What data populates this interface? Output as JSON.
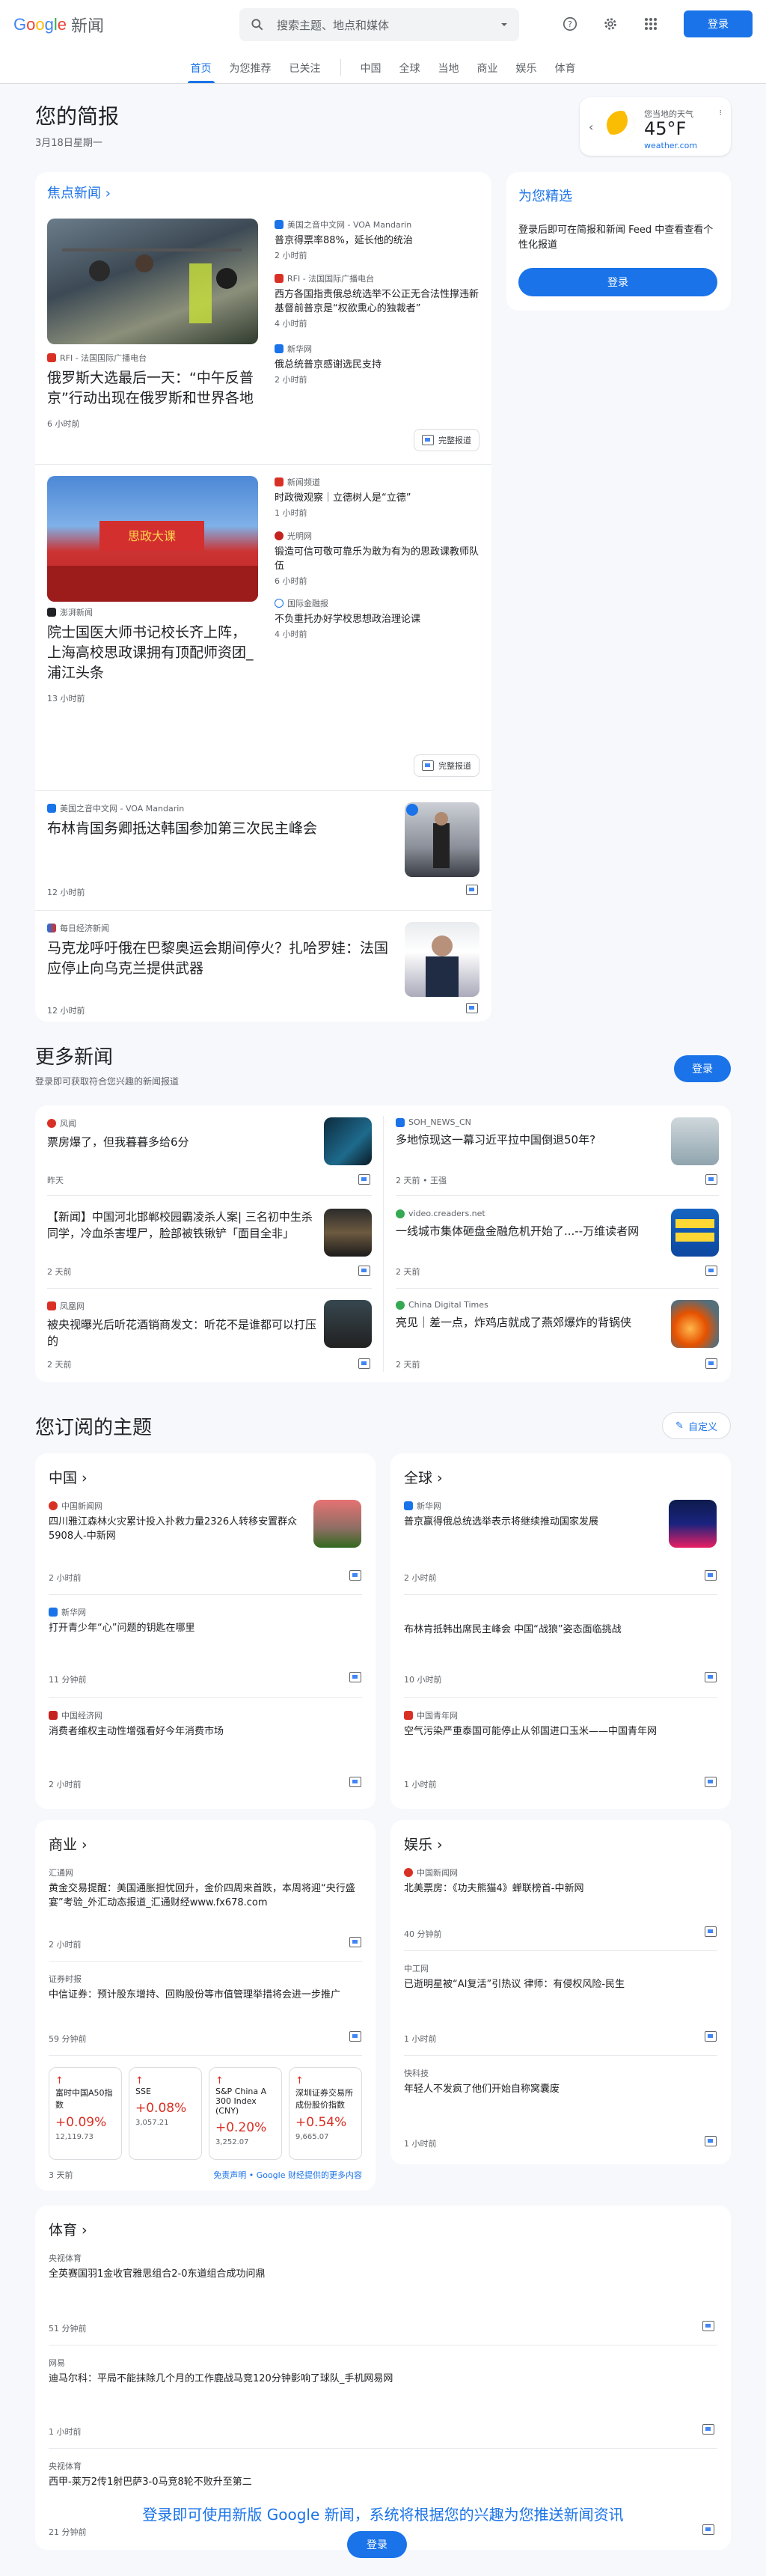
{
  "header": {
    "logo_letters": [
      "G",
      "o",
      "o",
      "g",
      "l",
      "e"
    ],
    "logo_suffix": "新闻",
    "search_placeholder": "搜索主题、地点和媒体",
    "login_label": "登录"
  },
  "nav": {
    "tabs": [
      "首页",
      "为您推荐",
      "已关注",
      "中国",
      "全球",
      "当地",
      "商业",
      "娱乐",
      "体育"
    ],
    "active": "首页"
  },
  "briefing": {
    "title": "您的简报",
    "date": "3月18日星期一"
  },
  "weather": {
    "location": "您当地的天气",
    "temp": "45°F",
    "source": "weather.com"
  },
  "top_stories": {
    "heading": "焦点新闻",
    "full_coverage_label": "完整报道",
    "clusters": [
      {
        "main": {
          "source": "RFI - 法国国际广播电台",
          "title": "俄罗斯大选最后一天：“中午反普京”行动出现在俄罗斯和世界各地",
          "time": "6 小时前"
        },
        "side": [
          {
            "source": "美国之音中文网 - VOA Mandarin",
            "title": "普京得票率88%，延长他的统治",
            "time": "2 小时前"
          },
          {
            "source": "RFI - 法国国际广播电台",
            "title": "西方各国指责俄总统选举不公正无合法性撑违新基督前普京是“权欲熏心的独裁者”",
            "time": "4 小时前"
          },
          {
            "source": "新华网",
            "title": "俄总统普京感谢选民支持",
            "time": "2 小时前"
          }
        ]
      },
      {
        "main": {
          "source": "澎湃新闻",
          "title": "院士国医大师书记校长齐上阵，上海高校思政课拥有顶配师资团_浦江头条",
          "time": "13 小时前"
        },
        "side": [
          {
            "source": "新闻频道",
            "title": "时政微观察｜立德树人是“立德”",
            "time": "1 小时前"
          },
          {
            "source": "光明网",
            "title": "锻造可信可敬可靠乐为敢为有为的思政课教师队伍",
            "time": "6 小时前"
          },
          {
            "source": "国际金融报",
            "title": "不负重托办好学校思想政治理论课",
            "time": "4 小时前"
          }
        ]
      }
    ],
    "singles": [
      {
        "source": "美国之音中文网 - VOA Mandarin",
        "title": "布林肯国务卿抵达韩国参加第三次民主峰会",
        "time": "12 小时前"
      },
      {
        "source": "每日经济新闻",
        "title": "马克龙呼吁俄在巴黎奥运会期间停火？扎哈罗娃：法国应停止向乌克兰提供武器",
        "time": "12 小时前"
      }
    ]
  },
  "picks": {
    "title": "为您精选",
    "text": "登录后即可在简报和新闻 Feed 中查看查看个性化报道",
    "button": "登录"
  },
  "more_news": {
    "title": "更多新闻",
    "subtitle": "登录即可获取符合您兴趣的新闻报道",
    "button": "登录",
    "items": [
      {
        "source": "风闻",
        "title": "票房爆了，但我暮暮多给6分",
        "time": "昨天"
      },
      {
        "source": "SOH_NEWS_CN",
        "title": "多地惊现这一幕习近平拉中国倒退50年?",
        "time": "2 天前 • 王强"
      },
      {
        "source": "",
        "title": "【新闻】中国河北邯郸校园霸凌杀人案| 三名初中生杀同学，冷血杀害埋尸，脸部被铁锹铲「面目全非」",
        "time": "2 天前"
      },
      {
        "source": "video.creaders.net",
        "title": "一线城市集体砸盘金融危机开始了...--万维读者网",
        "time": "2 天前"
      },
      {
        "source": "凤凰网",
        "title": "被央视曝光后听花酒销商发文：听花不是谁都可以打压的",
        "time": "2 天前"
      },
      {
        "source": "China Digital Times",
        "title": "亮见｜差一点，炸鸡店就成了燕郊爆炸的背锅侠",
        "time": "2 天前"
      }
    ]
  },
  "subscribed": {
    "title": "您订阅的主题",
    "customize": "自定义",
    "topics": [
      {
        "name": "中国",
        "items": [
          {
            "source": "中国新闻网",
            "title": "四川雅江森林火灾累计投入扑救力量2326人转移安置群众5908人-中新网",
            "time": "2 小时前"
          },
          {
            "source": "新华网",
            "title": "打开青少年“心”问题的钥匙在哪里",
            "time": "11 分钟前"
          },
          {
            "source": "中国经济网",
            "title": "消费者维权主动性增强看好今年消费市场",
            "time": "2 小时前"
          }
        ]
      },
      {
        "name": "全球",
        "items": [
          {
            "source": "新华网",
            "title": "普京赢得俄总统选举表示将继续推动国家发展",
            "time": "2 小时前"
          },
          {
            "source": "",
            "title": "布林肯抵韩出席民主峰会 中国“战狼”姿态面临挑战",
            "time": "10 小时前"
          },
          {
            "source": "中国青年网",
            "title": "空气污染严重泰国可能停止从邻国进口玉米——中国青年网",
            "time": "1 小时前"
          }
        ]
      },
      {
        "name": "商业",
        "items": [
          {
            "source": "汇通网",
            "title": "黄金交易提醒：美国通胀担忧回升，金价四周来首跌，本周将迎“央行盛宴”考验_外汇动态报道_汇通财经www.fx678.com",
            "time": "2 小时前"
          },
          {
            "source": "证券时报",
            "title": "中信证券：预计股东增持、回购股份等市值管理举措将会进一步推广",
            "time": "59 分钟前"
          }
        ],
        "stocks": [
          {
            "name": "富时中国A50指数",
            "pct": "+0.09%",
            "val": "12,119.73"
          },
          {
            "name": "SSE",
            "pct": "+0.08%",
            "val": "3,057.21"
          },
          {
            "name": "S&P China A 300 Index (CNY)",
            "pct": "+0.20%",
            "val": "3,252.07"
          },
          {
            "name": "深圳证券交易所成份股价指数",
            "pct": "+0.54%",
            "val": "9,665.07"
          }
        ],
        "stock_time": "3 天前",
        "disclaimer": "免责声明 • Google 财经提供的更多内容"
      },
      {
        "name": "娱乐",
        "items": [
          {
            "source": "中国新闻网",
            "title": "北美票房：《功夫熊猫4》蝉联榜首-中新网",
            "time": "40 分钟前"
          },
          {
            "source": "中工网",
            "title": "已逝明星被“AI复活”引热议 律师：有侵权风险-民生",
            "time": "1 小时前"
          },
          {
            "source": "快科技",
            "title": "年轻人不发疯了他们开始自称窝囊废",
            "time": "1 小时前"
          }
        ]
      },
      {
        "name": "体育",
        "items": [
          {
            "source": "央视体育",
            "title": "全英赛国羽1金收官雅思组合2-0东道组合成功问鼎",
            "time": "51 分钟前"
          },
          {
            "source": "网易",
            "title": "迪马尔科：平局不能抹除几个月的工作鹿战马竞120分钟影响了球队_手机网易网",
            "time": "1 小时前"
          },
          {
            "source": "央视体育",
            "title": "西甲-莱万2传1射巴萨3-0马竞8轮不败升至第二",
            "time": "21 分钟前"
          }
        ]
      }
    ]
  },
  "footer": {
    "cta": "登录即可使用新版 Google 新闻，系统将根据您的兴趣为您推送新闻资讯",
    "button": "登录"
  },
  "colors": {
    "accent": "#1a73e8",
    "up": "#d93025"
  }
}
